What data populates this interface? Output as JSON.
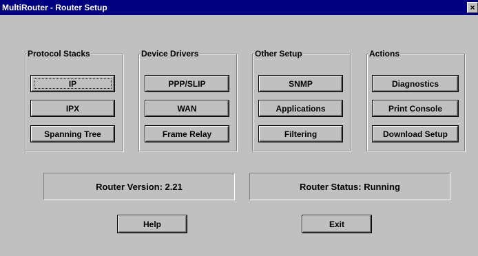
{
  "window": {
    "title": "MultiRouter - Router Setup",
    "close_label": "×"
  },
  "groups": {
    "protocol_stacks": {
      "label": "Protocol Stacks",
      "buttons": [
        {
          "label": "IP"
        },
        {
          "label": "IPX"
        },
        {
          "label": "Spanning Tree"
        }
      ]
    },
    "device_drivers": {
      "label": "Device Drivers",
      "buttons": [
        {
          "label": "PPP/SLIP"
        },
        {
          "label": "WAN"
        },
        {
          "label": "Frame Relay"
        }
      ]
    },
    "other_setup": {
      "label": "Other Setup",
      "buttons": [
        {
          "label": "SNMP"
        },
        {
          "label": "Applications"
        },
        {
          "label": "Filtering"
        }
      ]
    },
    "actions": {
      "label": "Actions",
      "buttons": [
        {
          "label": "Diagnostics"
        },
        {
          "label": "Print Console"
        },
        {
          "label": "Download Setup"
        }
      ]
    }
  },
  "status": {
    "version_text": "Router Version: 2.21",
    "status_text": "Router Status: Running"
  },
  "footer": {
    "help_label": "Help",
    "exit_label": "Exit"
  }
}
